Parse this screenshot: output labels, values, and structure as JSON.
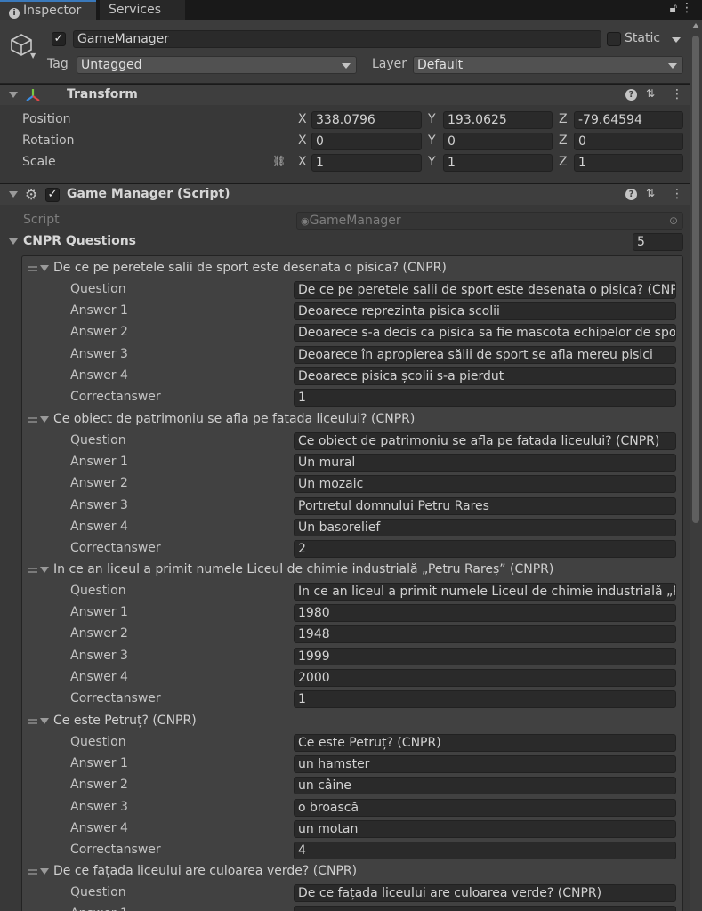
{
  "tabs": {
    "inspector": "Inspector",
    "services": "Services"
  },
  "gameobject": {
    "name": "GameManager",
    "static_label": "Static",
    "tag_label": "Tag",
    "tag_value": "Untagged",
    "layer_label": "Layer",
    "layer_value": "Default"
  },
  "transform": {
    "title": "Transform",
    "rows": [
      {
        "label": "Position",
        "x": "338.0796",
        "y": "193.0625",
        "z": "-79.64594"
      },
      {
        "label": "Rotation",
        "x": "0",
        "y": "0",
        "z": "0"
      },
      {
        "label": "Scale",
        "x": "1",
        "y": "1",
        "z": "1"
      }
    ],
    "axes": {
      "x": "X",
      "y": "Y",
      "z": "Z"
    }
  },
  "script_component": {
    "title": "Game Manager (Script)",
    "script_label": "Script",
    "script_value": "GameManager",
    "list_label": "CNPR Questions",
    "list_count": "5"
  },
  "field_labels": {
    "question": "Question",
    "answer1": "Answer 1",
    "answer2": "Answer 2",
    "answer3": "Answer 3",
    "answer4": "Answer 4",
    "correct": "Correctanswer"
  },
  "questions": [
    {
      "title": "De ce pe peretele salii de sport este desenata o pisica? (CNPR)",
      "question": "De ce pe peretele salii de sport este desenata o pisica? (CNPR)",
      "answer1": "Deoarece reprezinta pisica scolii",
      "answer2": "Deoarece s-a decis ca pisica sa fie mascota echipelor de sport",
      "answer3": "Deoarece în apropierea sălii de sport se afla mereu pisici",
      "answer4": "Deoarece pisica școlii s-a pierdut",
      "correct": "1"
    },
    {
      "title": "Ce obiect de patrimoniu se afla pe fatada liceului?    (CNPR)",
      "question": "Ce obiect de patrimoniu se afla pe fatada liceului?    (CNPR)",
      "answer1": "Un mural",
      "answer2": "Un mozaic",
      "answer3": "Portretul domnului Petru Rares",
      "answer4": "Un basorelief",
      "correct": "2"
    },
    {
      "title": "In ce an liceul a primit numele Liceul de chimie industrială „Petru Rareș” (CNPR)",
      "question": "In ce an liceul a primit numele Liceul de chimie industrială „Petru Rareș” (CNPR)",
      "answer1": "1980",
      "answer2": "1948",
      "answer3": "1999",
      "answer4": "2000",
      "correct": "1"
    },
    {
      "title": "Ce este Petruț?  (CNPR)",
      "question": "Ce este Petruț?  (CNPR)",
      "answer1": "un hamster",
      "answer2": "un câine",
      "answer3": "o broască",
      "answer4": "un motan",
      "correct": "4"
    },
    {
      "title": "De ce fațada liceului are culoarea verde?  (CNPR)",
      "question": "De ce fațada liceului are culoarea verde?  (CNPR)",
      "answer1": "",
      "answer2": "",
      "answer3": "",
      "answer4": "",
      "correct": ""
    }
  ]
}
